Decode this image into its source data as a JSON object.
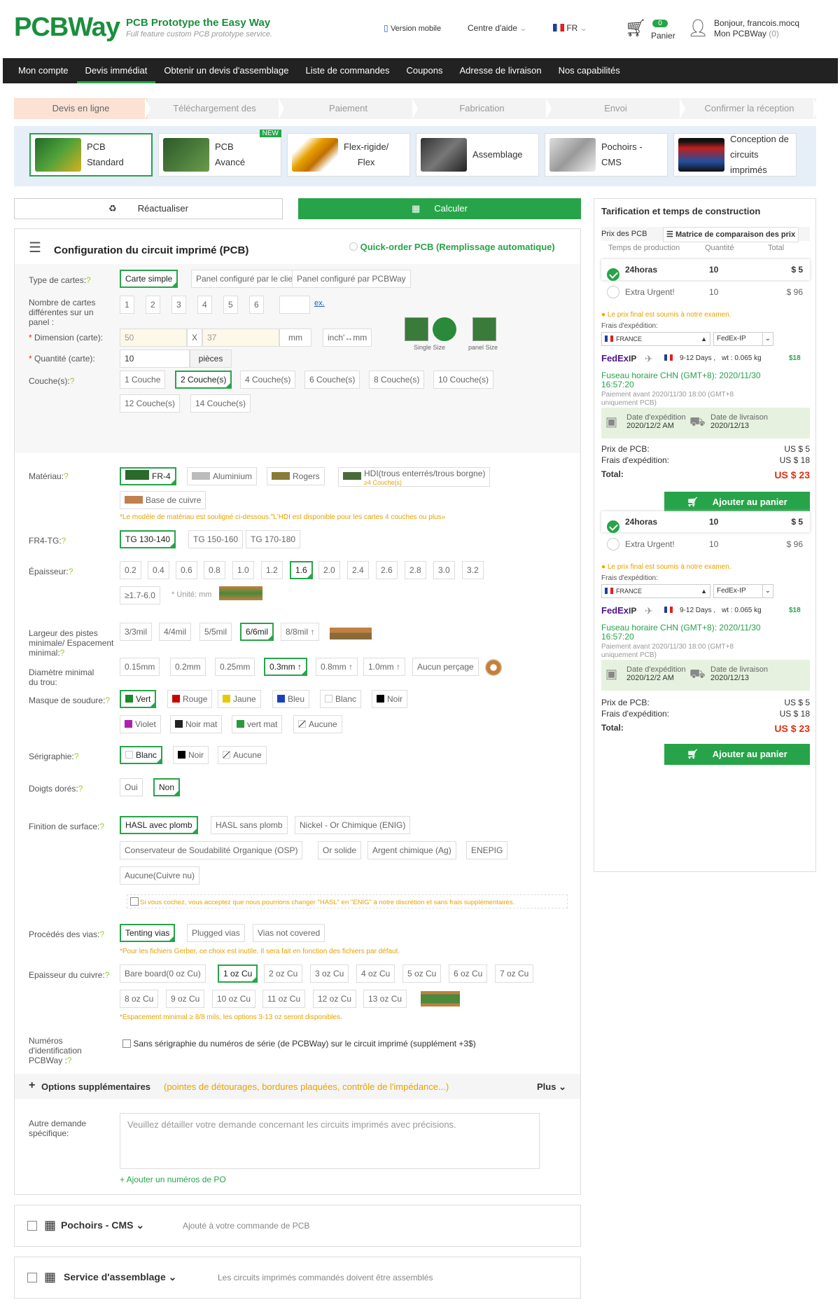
{
  "header": {
    "logo": "PCBWay",
    "tagline": "PCB Prototype the Easy Way",
    "tagsub": "Full feature custom PCB prototype service.",
    "mobile": "Version mobile",
    "help": "Centre d'aide",
    "lang": "FR",
    "cart_count": "0",
    "cart_label": "Panier",
    "greeting": "Bonjour, francois.mocq",
    "account": "Mon PCBWay",
    "account_count": "(0)"
  },
  "nav": [
    "Mon compte",
    "Devis immédiat",
    "Obtenir un devis d'assemblage",
    "Liste de commandes",
    "Coupons",
    "Adresse de livraison",
    "Nos capabilités"
  ],
  "steps": [
    "Devis en ligne",
    "Téléchargement des",
    "Paiement",
    "Fabrication",
    "Envoi",
    "Confirmer la réception"
  ],
  "products": [
    {
      "l1": "PCB",
      "l2": "Standard"
    },
    {
      "l1": "PCB",
      "l2": "Avancé",
      "tag": "NEW"
    },
    {
      "l1": "Flex-rigide/",
      "l2": "Flex"
    },
    {
      "l1": "Assemblage",
      "l2": ""
    },
    {
      "l1": "Pochoirs - CMS",
      "l2": ""
    },
    {
      "l1": "Conception de",
      "l2": "circuits imprimés"
    }
  ],
  "buttons": {
    "refresh": "Réactualiser",
    "calc": "Calculer"
  },
  "config": {
    "title": "Configuration du circuit imprimé (PCB)",
    "quick": "Quick-order PCB (Remplissage automatique)",
    "board_type_lbl": "Type de cartes:",
    "board_types": [
      "Carte simple",
      "Panel configuré par le client",
      "Panel configuré par PCBWay"
    ],
    "nb_lbl": "Nombre de cartes différentes sur un panel :",
    "nb": [
      "1",
      "2",
      "3",
      "4",
      "5",
      "6"
    ],
    "ex": "ex.",
    "dim_lbl": "Dimension (carte):",
    "dim_w": "50",
    "dim_x": "X",
    "dim_h": "37",
    "dim_unit": "mm",
    "inch": "inch'↔mm",
    "single": "Single Size",
    "panel": "panel Size",
    "qty_lbl": "Quantité (carte):",
    "qty": "10",
    "qty_unit": "pièces",
    "layers_lbl": "Couche(s):",
    "layers": [
      "1 Couche",
      "2 Couche(s)",
      "4 Couche(s)",
      "6 Couche(s)",
      "8 Couche(s)",
      "10 Couche(s)",
      "12 Couche(s)",
      "14 Couche(s)"
    ],
    "mat_lbl": "Matériau:",
    "mats": [
      "FR-4",
      "Aluminium",
      "Rogers",
      "HDI(trous enterrés/trous borgne)",
      "Base de cuivre"
    ],
    "hdi_sub": "≥4 Couche(s)",
    "mat_note": "*Le modèle de matériau est souligné ci-dessous.\"L'HDI est disponible pour les cartes 4 couches ou plus»",
    "tg_lbl": "FR4-TG:",
    "tgs": [
      "TG 130-140",
      "TG 150-160",
      "TG 170-180"
    ],
    "thick_lbl": "Épaisseur:",
    "thicks": [
      "0.2",
      "0.4",
      "0.6",
      "0.8",
      "1.0",
      "1.2",
      "1.6",
      "2.0",
      "2.4",
      "2.6",
      "2.8",
      "3.0",
      "3.2",
      "≥1.7-6.0"
    ],
    "thick_unit": "* Unité: mm",
    "track_lbl": "Largeur des pistes minimale/ Espacement minimal:",
    "tracks": [
      "3/3mil",
      "4/4mil",
      "5/5mil",
      "6/6mil",
      "8/8mil ↑"
    ],
    "hole_lbl": "Diamètre minimal du trou:",
    "holes": [
      "0.15mm",
      "0.2mm",
      "0.25mm",
      "0.3mm ↑",
      "0.8mm ↑",
      "1.0mm ↑",
      "Aucun perçage"
    ],
    "mask_lbl": "Masque de soudure:",
    "masks": [
      "Vert",
      "Rouge",
      "Jaune",
      "Bleu",
      "Blanc",
      "Noir",
      "Violet",
      "Noir mat",
      "vert mat",
      "Aucune"
    ],
    "silk_lbl": "Sérigraphie:",
    "silks": [
      "Blanc",
      "Noir",
      "Aucune"
    ],
    "gold_lbl": "Doigts dorés:",
    "golds": [
      "Oui",
      "Non"
    ],
    "finish_lbl": "Finition de surface:",
    "finishes": [
      "HASL avec plomb",
      "HASL sans plomb",
      "Nickel - Or Chimique (ENIG)",
      "Conservateur de Soudabilité Organique (OSP)",
      "Or solide",
      "Argent chimique (Ag)",
      "ENEPIG",
      "Aucune(Cuivre nu)"
    ],
    "finish_note": "Si vous cochez, vous acceptez que nous pourrions changer \"HASL\" en \"ENIG\" à notre discrétion et sans frais supplémentaires.",
    "via_lbl": "Procédés des vias:",
    "vias": [
      "Tenting vias",
      "Plugged vias",
      "Vias not covered"
    ],
    "via_note": "*Pour les fichiers Gerber, ce choix est inutile. Il sera fait en fonction des fichiers par défaut.",
    "cu_lbl": "Epaisseur du cuivre:",
    "cus": [
      "Bare board(0 oz Cu)",
      "1 oz Cu",
      "2 oz Cu",
      "3 oz Cu",
      "4 oz Cu",
      "5 oz Cu",
      "6 oz Cu",
      "7 oz Cu",
      "8 oz Cu",
      "9 oz Cu",
      "10 oz Cu",
      "11 oz Cu",
      "12 oz Cu",
      "13 oz Cu"
    ],
    "cu_note": "*Espacement minimal ≥ 8/8 mils, les options 3-13 oz seront disponibles.",
    "id_lbl": "Numéros d'identification PCBWay :",
    "id_opt": "Sans sérigraphie du numéros de série (de PCBWay) sur le circuit imprimé (supplément +3$)",
    "extra_title": "Options supplémentaires",
    "extra_sub": "(pointes de détourages, bordures plaquées, contrôle de l'impédance...)",
    "plus": "Plus",
    "other_lbl": "Autre demande spécifique:",
    "other_ph": "Veuillez détailler votre demande concernant les circuits imprimés avec précisions.",
    "po": "+ Ajouter un numéros de PO"
  },
  "stencil": {
    "title": "Pochoirs - CMS",
    "sub": "Ajouté à votre commande de PCB"
  },
  "assembly": {
    "title": "Service d'assemblage",
    "sub": "Les circuits imprimés commandés doivent être assemblés"
  },
  "side": {
    "title": "Tarification et temps de construction",
    "price_lbl": "Prix des PCB",
    "matrix": "Matrice de comparaison des prix",
    "cols": [
      "Temps de production",
      "Quantité",
      "Total"
    ],
    "rows": [
      {
        "name": "24horas",
        "qty": "10",
        "total": "$ 5"
      },
      {
        "name": "Extra Urgent!",
        "qty": "10",
        "total": "$ 96"
      }
    ],
    "final_note": "Le prix final est soumis à notre examen.",
    "ship_lbl": "Frais d'expédition:",
    "country": "FRANCE",
    "carrier": "FedEx-IP",
    "fedex": "FedEx",
    "ip": "IP",
    "days": "9-12 Days ,",
    "wt": "wt : 0.065 kg",
    "ship_price": "$18",
    "tz": "Fuseau horaire CHN (GMT+8): 2020/11/30 16:57:20",
    "pay": "Paiement avant 2020/11/30 18:00 (GMT+8 uniquement PCB)",
    "exp_lbl": "Date d'expédition",
    "exp": "2020/12/2 AM",
    "del_lbl": "Date de livraison",
    "del": "2020/12/13",
    "pcb_price_lbl": "Prix de PCB:",
    "pcb_price": "US $ 5",
    "ship_cost_lbl": "Frais d'expédition:",
    "ship_cost": "US $ 18",
    "total_lbl": "Total:",
    "total": "US $ 23",
    "add": "Ajouter au panier"
  }
}
